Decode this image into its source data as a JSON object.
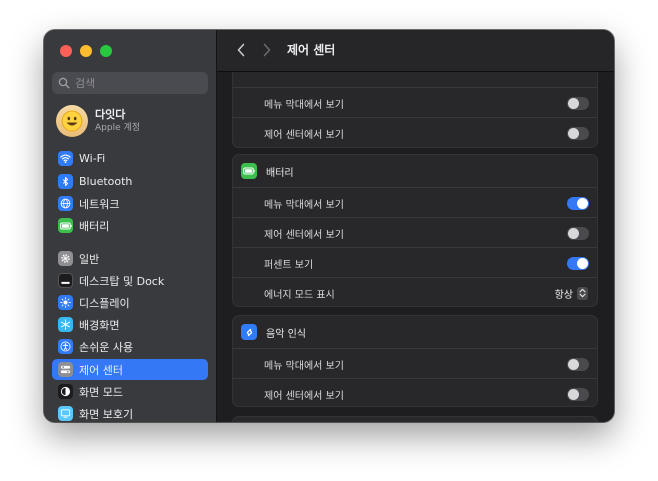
{
  "sidebar": {
    "search_placeholder": "검색",
    "account": {
      "name": "다잇다",
      "subtitle": "Apple 계정"
    },
    "items": [
      {
        "label": "Wi-Fi",
        "icon": "wifi-icon",
        "color": "#2f7cf6"
      },
      {
        "label": "Bluetooth",
        "icon": "bluetooth-icon",
        "color": "#2f7cf6"
      },
      {
        "label": "네트워크",
        "icon": "globe-icon",
        "color": "#2f7cf6"
      },
      {
        "label": "배터리",
        "icon": "battery-icon",
        "color": "#3cbf4c"
      },
      {
        "label": "일반",
        "icon": "gear-icon",
        "color": "#8e8e93"
      },
      {
        "label": "데스크탑 및 Dock",
        "icon": "dock-icon",
        "color": "#1c1c1e"
      },
      {
        "label": "디스플레이",
        "icon": "sun-icon",
        "color": "#2f7cf6"
      },
      {
        "label": "배경화면",
        "icon": "snowflake-icon",
        "color": "#37b8f0"
      },
      {
        "label": "손쉬운 사용",
        "icon": "accessibility-icon",
        "color": "#2f7cf6"
      },
      {
        "label": "제어 센터",
        "icon": "control-center-icon",
        "color": "#8e8e93",
        "selected": true
      },
      {
        "label": "화면 모드",
        "icon": "appearance-icon",
        "color": "#1c1c1e"
      },
      {
        "label": "화면 보호기",
        "icon": "screensaver-icon",
        "color": "#5ac8fa"
      }
    ]
  },
  "header": {
    "title": "제어 센터"
  },
  "groups": [
    {
      "rows": [
        {
          "label": "메뉴 막대에서 보기",
          "on": false
        },
        {
          "label": "제어 센터에서 보기",
          "on": false
        }
      ]
    },
    {
      "title": "배터리",
      "icon": "battery-icon",
      "color": "#3cbf4c",
      "rows": [
        {
          "label": "메뉴 막대에서 보기",
          "on": true
        },
        {
          "label": "제어 센터에서 보기",
          "on": false
        },
        {
          "label": "퍼센트 보기",
          "on": true
        },
        {
          "label": "에너지 모드 표시",
          "value": "항상"
        }
      ]
    },
    {
      "title": "음악 인식",
      "icon": "shazam-icon",
      "color": "#2f7cf6",
      "rows": [
        {
          "label": "메뉴 막대에서 보기",
          "on": false
        },
        {
          "label": "제어 센터에서 보기",
          "on": false
        }
      ]
    }
  ]
}
